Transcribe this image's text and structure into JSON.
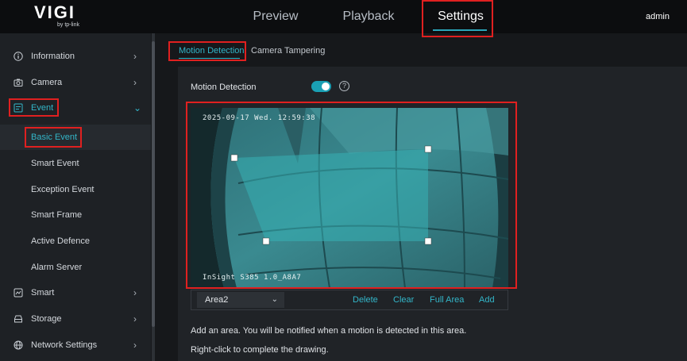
{
  "header": {
    "logo_text": "VIGI",
    "logo_sub": "by tp-link",
    "tabs": [
      {
        "label": "Preview"
      },
      {
        "label": "Playback"
      },
      {
        "label": "Settings"
      }
    ],
    "user": "admin",
    "accent": "#2aa5b8"
  },
  "sidebar": {
    "items": [
      {
        "label": "Information",
        "icon": "info-icon"
      },
      {
        "label": "Camera",
        "icon": "camera-icon"
      },
      {
        "label": "Event",
        "icon": "event-icon"
      },
      {
        "label": "Smart",
        "icon": "smart-icon"
      },
      {
        "label": "Storage",
        "icon": "storage-icon"
      },
      {
        "label": "Network Settings",
        "icon": "globe-icon"
      }
    ],
    "event_sub": [
      {
        "label": "Basic Event"
      },
      {
        "label": "Smart Event"
      },
      {
        "label": "Exception Event"
      },
      {
        "label": "Smart Frame"
      },
      {
        "label": "Active Defence"
      },
      {
        "label": "Alarm Server"
      }
    ]
  },
  "content": {
    "tabs": [
      {
        "label": "Motion Detection"
      },
      {
        "label": "Camera Tampering"
      }
    ],
    "motion_label": "Motion Detection",
    "motion_enabled": true,
    "help_glyph": "?",
    "video": {
      "timestamp": "2025-09-17 Wed. 12:59:38",
      "camera_name": "InSight S385 1.0_A8A7"
    },
    "area_select": {
      "value": "Area2",
      "arrow": "⌄"
    },
    "actions": {
      "delete": "Delete",
      "clear": "Clear",
      "full_area": "Full Area",
      "add": "Add"
    },
    "note1": "Add an area. You will be notified when a motion is detected in this area.",
    "note2": "Right-click to complete the drawing."
  }
}
